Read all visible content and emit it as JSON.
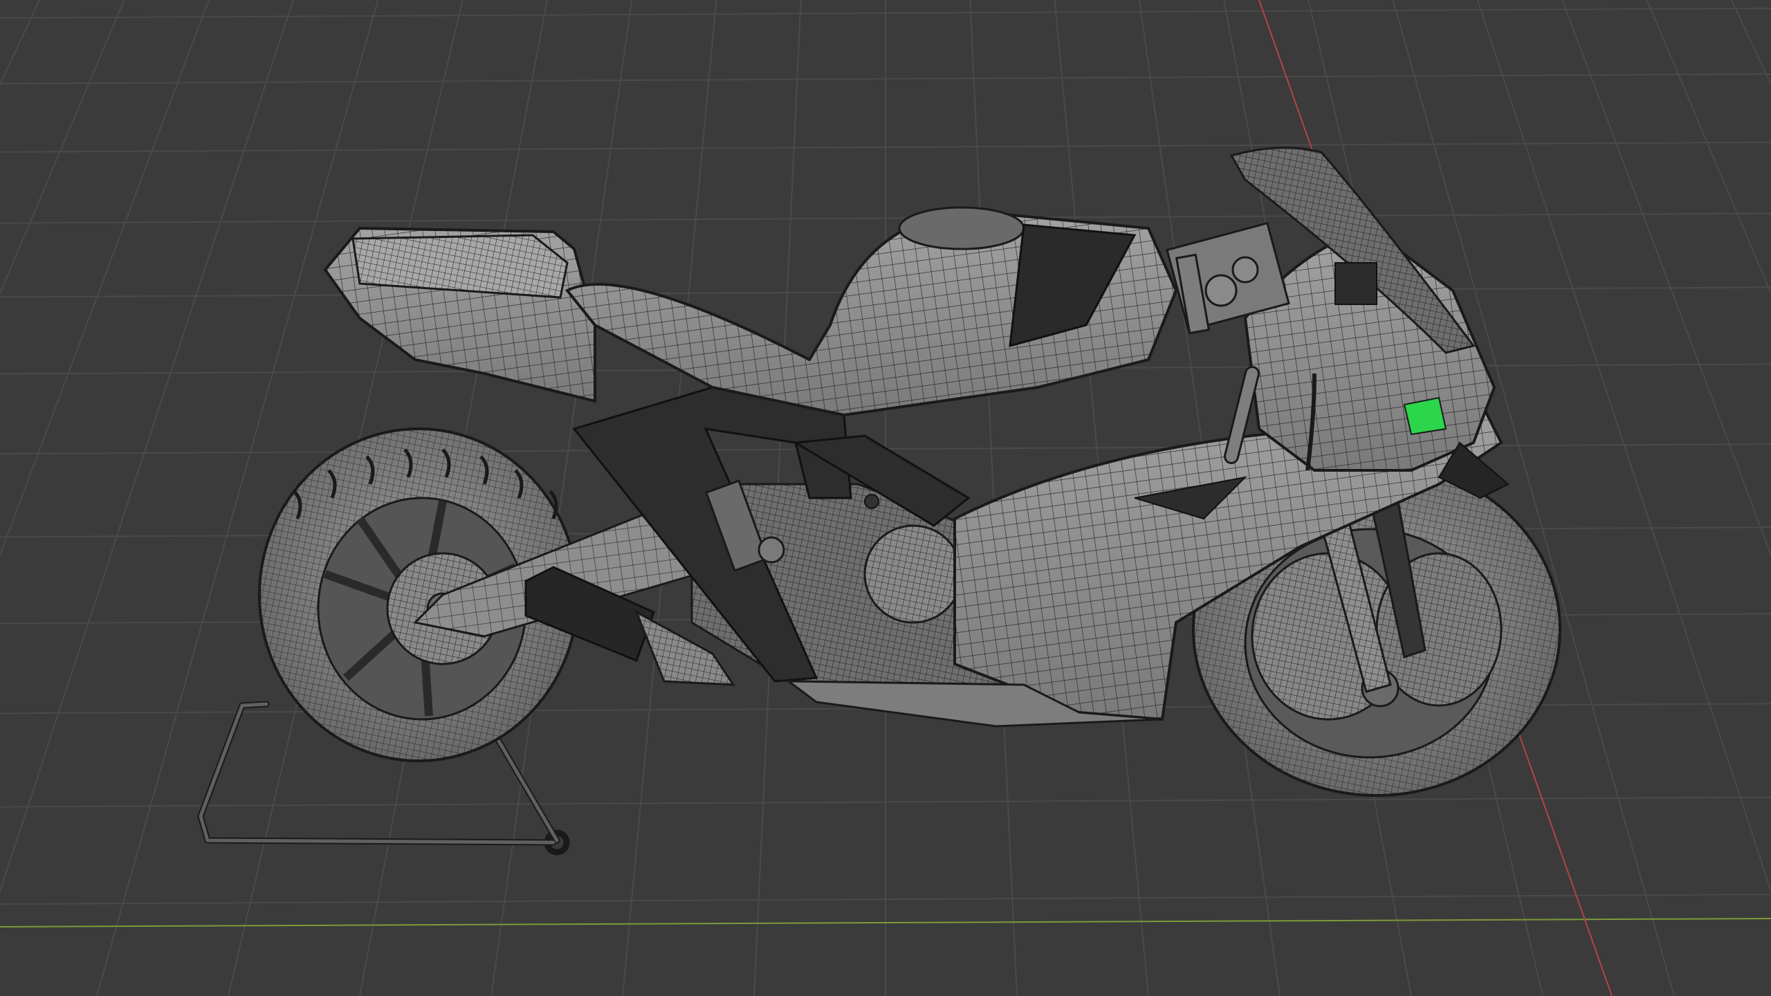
{
  "app": {
    "name": "3D viewport",
    "mode": "wireframe-overlay"
  },
  "viewport": {
    "background_color": "#3b3b3b",
    "grid_color": "#4a4a4a",
    "x_axis_color": "#7e9a3a",
    "y_axis_color": "#b3434b"
  },
  "scene": {
    "object_name": "motorcycle",
    "object_color": "#8c8c8c",
    "wire_color": "#1e1e1e",
    "accent_color": "#2bd64a",
    "stand_color": "#5a5a5a"
  },
  "icons": {
    "object": "motorcycle-icon",
    "stand": "paddock-stand-icon"
  }
}
